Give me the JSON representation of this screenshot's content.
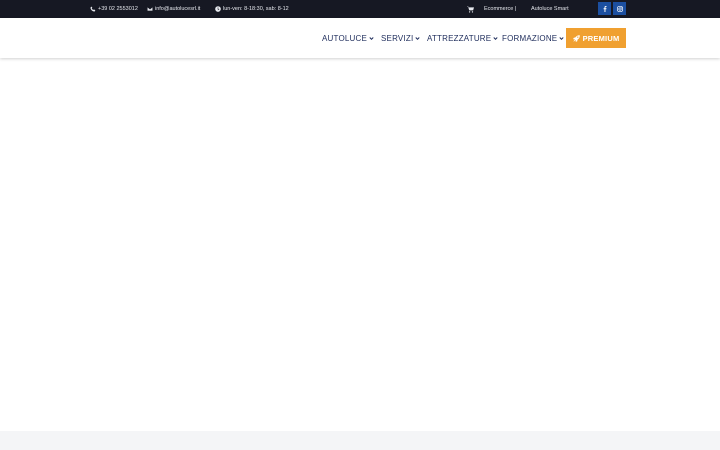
{
  "colors": {
    "topbar_bg": "#161823",
    "nav_text": "#1f2d5c",
    "accent": "#f0a030",
    "social_bg": "#1c4fa0",
    "footer_bg": "#f4f5f7"
  },
  "topbar": {
    "phone": {
      "icon": "phone-icon",
      "text": "+39 02 2553012"
    },
    "email": {
      "icon": "envelope-icon",
      "text": "info@autolucesrl.it"
    },
    "hours": {
      "icon": "clock-icon",
      "text": "lun-ven: 8-18:30, sab: 8-12"
    },
    "cart_icon": "shopping-cart-icon",
    "ecommerce_label": "Ecommerce |",
    "smart_label": "Autoluce Smart",
    "social": [
      {
        "icon": "facebook-icon"
      },
      {
        "icon": "instagram-icon"
      }
    ]
  },
  "nav": {
    "items": [
      {
        "label": "AUTOLUCE",
        "icon": "chevron-down-icon"
      },
      {
        "label": "SERVIZI",
        "icon": "chevron-down-icon"
      },
      {
        "label": "ATTREZZATURE",
        "icon": "chevron-down-icon"
      },
      {
        "label": "FORMAZIONE",
        "icon": "chevron-down-icon"
      }
    ],
    "premium": {
      "label": "PREMIUM",
      "icon": "rocket-icon"
    }
  }
}
